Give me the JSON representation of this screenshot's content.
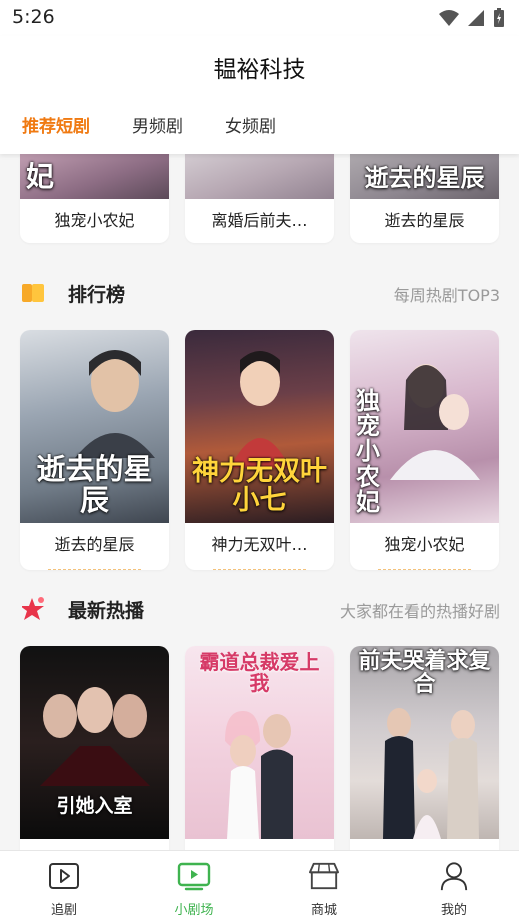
{
  "status": {
    "time": "5:26"
  },
  "header": {
    "title": "韫裕科技",
    "tabs": [
      "推荐短剧",
      "男频剧",
      "女频剧"
    ]
  },
  "top_row": [
    {
      "title": "独宠小农妃",
      "poster_text": "妃"
    },
    {
      "title": "离婚后前夫…",
      "poster_text": ""
    },
    {
      "title": "逝去的星辰",
      "poster_text": "逝去的星辰"
    }
  ],
  "ranking": {
    "title": "排行榜",
    "subtitle": "每周热剧TOP3",
    "items": [
      {
        "title": "逝去的星辰",
        "poster_text": "逝去的星辰"
      },
      {
        "title": "神力无双叶…",
        "poster_text": "神力无双叶小七"
      },
      {
        "title": "独宠小农妃",
        "poster_text": "独宠小农妃"
      }
    ]
  },
  "latest": {
    "title": "最新热播",
    "subtitle": "大家都在看的热播好剧",
    "items": [
      {
        "poster_text": "引她入室"
      },
      {
        "poster_text": "霸道总裁爱上我"
      },
      {
        "poster_text": "前夫哭着求复合"
      }
    ]
  },
  "bottom_nav": [
    {
      "label": "追剧",
      "icon": "play-square-icon"
    },
    {
      "label": "小剧场",
      "icon": "tv-icon"
    },
    {
      "label": "商城",
      "icon": "store-icon"
    },
    {
      "label": "我的",
      "icon": "user-icon"
    }
  ],
  "colors": {
    "accent": "#f07a12",
    "nav_active": "#3fb34f",
    "section_icon": "#f7a928"
  }
}
